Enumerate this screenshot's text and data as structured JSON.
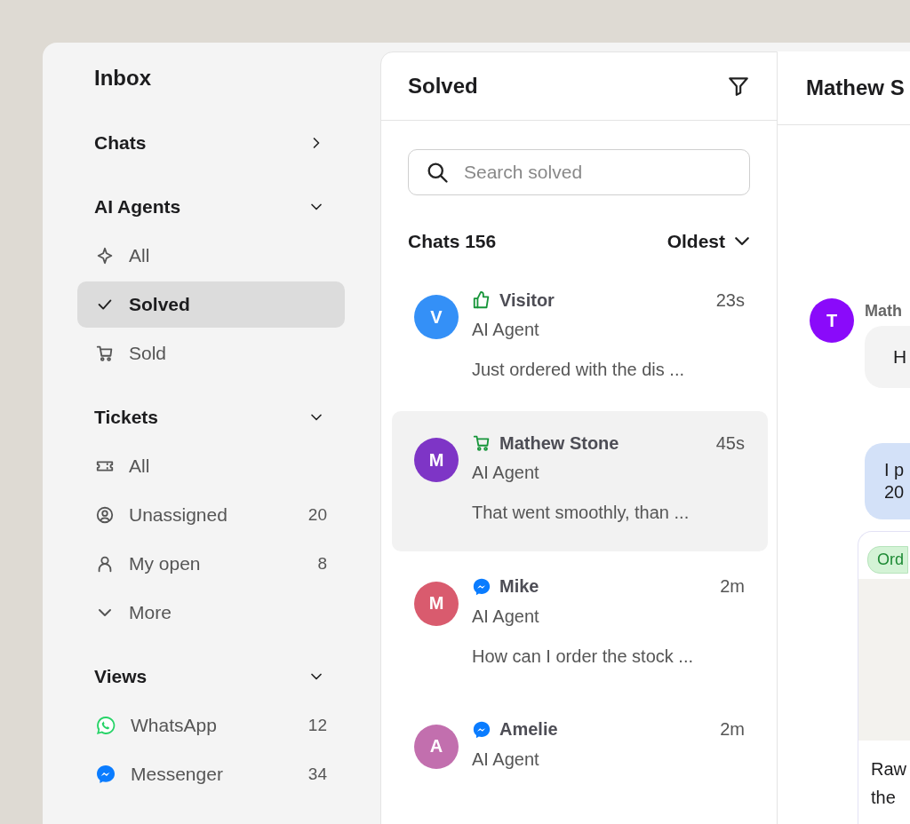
{
  "sidebar": {
    "title": "Inbox",
    "sections": [
      {
        "title": "Chats",
        "expanded": false
      },
      {
        "title": "AI Agents",
        "expanded": true,
        "items": [
          {
            "kind": "sparkle",
            "label": "All",
            "selected": false
          },
          {
            "kind": "check",
            "label": "Solved",
            "selected": true
          },
          {
            "kind": "cart",
            "label": "Sold",
            "selected": false
          }
        ]
      },
      {
        "title": "Tickets",
        "expanded": true,
        "items": [
          {
            "kind": "ticket",
            "label": "All",
            "selected": false
          },
          {
            "kind": "user-circle",
            "label": "Unassigned",
            "count": "20",
            "selected": false
          },
          {
            "kind": "user",
            "label": "My open",
            "count": "8",
            "selected": false
          },
          {
            "kind": "more",
            "label": "More",
            "selected": false
          }
        ]
      },
      {
        "title": "Views",
        "expanded": true,
        "items": [
          {
            "kind": "whatsapp",
            "label": "WhatsApp",
            "count": "12",
            "selected": false
          },
          {
            "kind": "messenger",
            "label": "Messenger",
            "count": "34",
            "selected": false
          }
        ]
      }
    ]
  },
  "list": {
    "title": "Solved",
    "search": {
      "placeholder": "Search solved"
    },
    "count_label": "Chats 156",
    "sort": "Oldest",
    "conversations": [
      {
        "initial": "V",
        "color": "#3490f7",
        "kind": "thumbs",
        "name": "Visitor",
        "time": "23s",
        "agent": "AI Agent",
        "preview": "Just ordered with the dis ...",
        "selected": false
      },
      {
        "initial": "M",
        "color": "#7e35c6",
        "kind": "cart",
        "name": "Mathew Stone",
        "time": "45s",
        "agent": "AI Agent",
        "preview": "That went smoothly, than ...",
        "selected": true
      },
      {
        "initial": "M",
        "color": "#d95b6e",
        "kind": "messenger",
        "name": "Mike",
        "time": "2m",
        "agent": "AI Agent",
        "preview": "How can I order the stock ...",
        "selected": false
      },
      {
        "initial": "A",
        "color": "#c26fae",
        "kind": "messenger",
        "name": "Amelie",
        "time": "2m",
        "agent": "AI Agent",
        "selected": false
      }
    ]
  },
  "chat": {
    "title": "Mathew S",
    "avatar": "T",
    "sender": "Math",
    "messages": [
      {
        "kind": "incoming",
        "lines": [
          "H"
        ]
      },
      {
        "kind": "outgoing",
        "lines": [
          "I p",
          "20"
        ]
      },
      {
        "kind": "product",
        "tag": "Ord",
        "lines": [
          "Raw",
          "the"
        ]
      }
    ]
  }
}
